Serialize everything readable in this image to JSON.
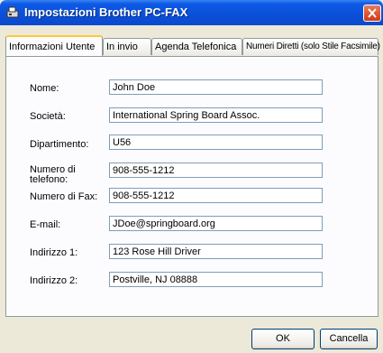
{
  "window": {
    "title": "Impostazioni Brother PC-FAX"
  },
  "tabs": [
    {
      "label": "Informazioni Utente",
      "active": true
    },
    {
      "label": "In invio",
      "active": false
    },
    {
      "label": "Agenda Telefonica",
      "active": false
    },
    {
      "label": "Numeri Diretti (solo Stile Facsimile)",
      "active": false
    }
  ],
  "form": {
    "name": {
      "label": "Nome:",
      "value": "John Doe"
    },
    "company": {
      "label": "Società:",
      "value": "International Spring Board Assoc."
    },
    "department": {
      "label": "Dipartimento:",
      "value": "U56"
    },
    "phone": {
      "label_line1": "Numero di",
      "label_line2": "telefono:",
      "value": "908-555-1212"
    },
    "fax": {
      "label": "Numero di Fax:",
      "value": "908-555-1212"
    },
    "email": {
      "label": "E-mail:",
      "value": "JDoe@springboard.org"
    },
    "address1": {
      "label": "Indirizzo 1:",
      "value": "123 Rose Hill Driver"
    },
    "address2": {
      "label": "Indirizzo 2:",
      "value": "Postville, NJ 08888"
    }
  },
  "buttons": {
    "ok": "OK",
    "cancel": "Cancella"
  },
  "colors": {
    "titlebar": "#0a4fd8",
    "tab_highlight": "#ffc73c",
    "close": "#cf3b16"
  }
}
